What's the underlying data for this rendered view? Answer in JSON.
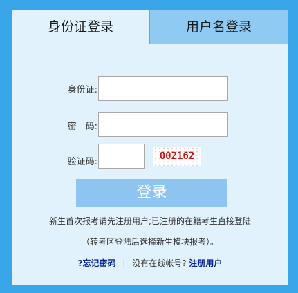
{
  "tabs": {
    "id_login": "身份证登录",
    "username_login": "用户名登录"
  },
  "form": {
    "id_label": "身份证:",
    "password_label": "密　码:",
    "captcha_label": "验证码:",
    "id_value": "",
    "password_value": "",
    "captcha_value": "",
    "captcha_image_text": "002162"
  },
  "login_button": "登录",
  "notes": {
    "line1": "新生首次报考请先注册用户;已注册的在籍考生直接登陆",
    "line2": "（转考区登陆后选择新生模块报考）。"
  },
  "links": {
    "forgot_password": "?忘记密码",
    "separator": "|",
    "no_account": "没有在线帐号?",
    "register": "注册用户"
  },
  "colors": {
    "outer_background": "#3aa6ea",
    "panel_background": "#e1f2fc",
    "inactive_tab": "#8fcaf3",
    "login_button": "#8dc5f0",
    "link": "#0a2a9c"
  }
}
